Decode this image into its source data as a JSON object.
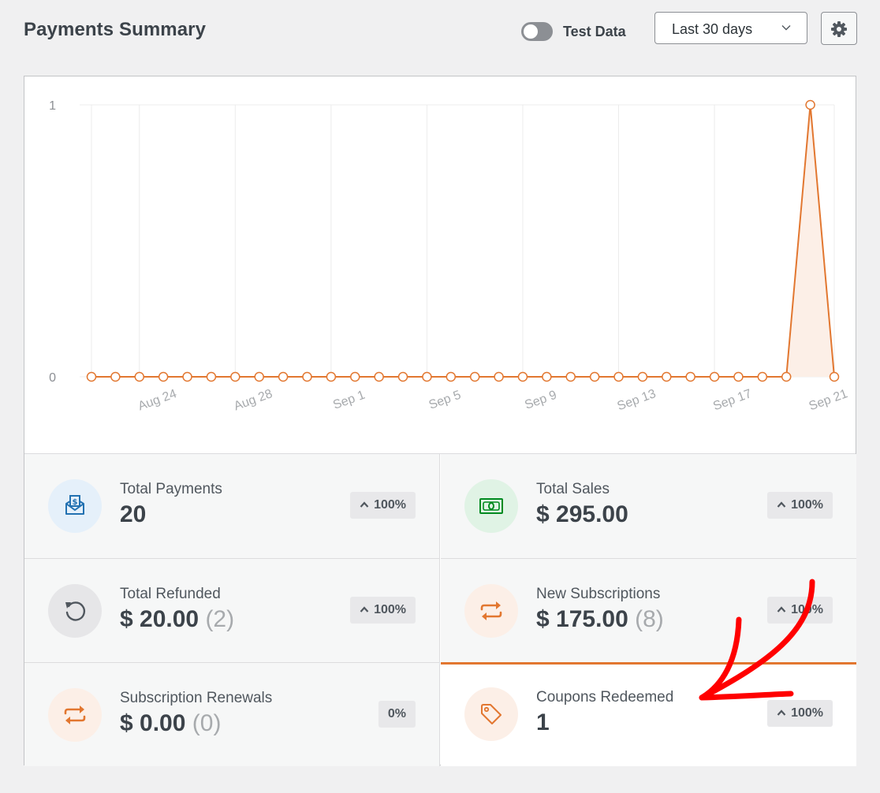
{
  "header": {
    "title": "Payments Summary",
    "test_data_label": "Test Data",
    "test_data_enabled": false,
    "range": {
      "selected": "Last 30 days"
    },
    "settings_icon": "gear-icon"
  },
  "chart_data": {
    "type": "area",
    "x_tick_labels": [
      "Aug 24",
      "Aug 28",
      "Sep 1",
      "Sep 5",
      "Sep 9",
      "Sep 13",
      "Sep 17",
      "Sep 21"
    ],
    "y_tick_labels": [
      "0",
      "1"
    ],
    "ylim": [
      0,
      1
    ],
    "x": [
      "Aug 21",
      "Aug 22",
      "Aug 23",
      "Aug 24",
      "Aug 25",
      "Aug 26",
      "Aug 27",
      "Aug 28",
      "Aug 29",
      "Aug 30",
      "Aug 31",
      "Sep 1",
      "Sep 2",
      "Sep 3",
      "Sep 4",
      "Sep 5",
      "Sep 6",
      "Sep 7",
      "Sep 8",
      "Sep 9",
      "Sep 10",
      "Sep 11",
      "Sep 12",
      "Sep 13",
      "Sep 14",
      "Sep 15",
      "Sep 16",
      "Sep 17",
      "Sep 18",
      "Sep 19",
      "Sep 20",
      "Sep 21"
    ],
    "series": [
      {
        "values": [
          0,
          0,
          0,
          0,
          0,
          0,
          0,
          0,
          0,
          0,
          0,
          0,
          0,
          0,
          0,
          0,
          0,
          0,
          0,
          0,
          0,
          0,
          0,
          0,
          0,
          0,
          0,
          0,
          0,
          0,
          1,
          0
        ]
      }
    ],
    "grid": true,
    "colors": {
      "line": "#e27730",
      "fill": "#fcefe7"
    }
  },
  "stats": [
    {
      "key": "total-payments",
      "label": "Total Payments",
      "value": "20",
      "count": "",
      "change": "100%",
      "trend": "up",
      "icon": "money-envelope-icon",
      "icon_color": "#2271b1",
      "icon_bg": "#e5f0fa",
      "active": false
    },
    {
      "key": "total-sales",
      "label": "Total Sales",
      "value": "$ 295.00",
      "count": "",
      "change": "100%",
      "trend": "up",
      "icon": "banknote-icon",
      "icon_color": "#008a20",
      "icon_bg": "#e0f3e5",
      "active": false
    },
    {
      "key": "total-refunded",
      "label": "Total Refunded",
      "value": "$ 20.00",
      "count": "(2)",
      "change": "100%",
      "trend": "up",
      "icon": "undo-icon",
      "icon_color": "#50575e",
      "icon_bg": "#e6e6e8",
      "active": false
    },
    {
      "key": "new-subscriptions",
      "label": "New Subscriptions",
      "value": "$ 175.00",
      "count": "(8)",
      "change": "100%",
      "trend": "up",
      "icon": "repeat-icon",
      "icon_color": "#e27730",
      "icon_bg": "#fcefe7",
      "active": false
    },
    {
      "key": "subscription-renewals",
      "label": "Subscription Renewals",
      "value": "$ 0.00",
      "count": "(0)",
      "change": "0%",
      "trend": "none",
      "icon": "repeat-icon",
      "icon_color": "#e27730",
      "icon_bg": "#fcefe7",
      "active": false
    },
    {
      "key": "coupons-redeemed",
      "label": "Coupons Redeemed",
      "value": "1",
      "count": "",
      "change": "100%",
      "trend": "up",
      "icon": "tag-icon",
      "icon_color": "#e27730",
      "icon_bg": "#fcefe7",
      "active": true
    }
  ],
  "annotation": {
    "icon": "hand-drawn-arrow-icon",
    "color": "#ff0000"
  }
}
